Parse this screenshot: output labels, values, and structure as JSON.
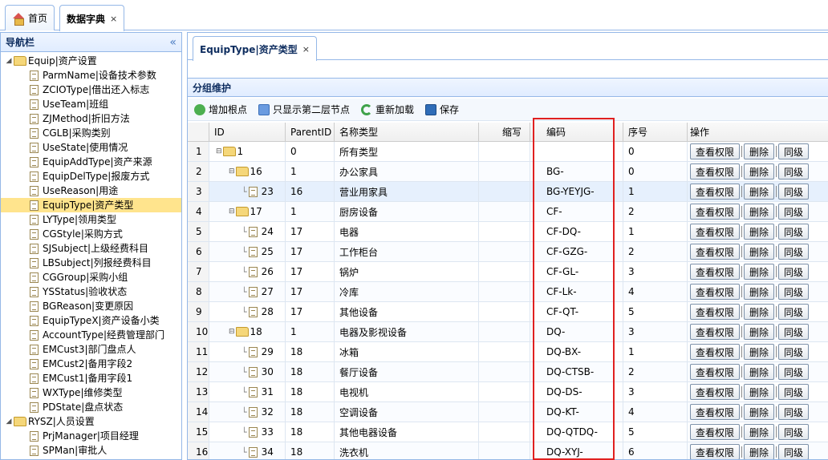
{
  "top_tabs": [
    {
      "label": "首页"
    },
    {
      "label": "数据字典",
      "close": "×"
    }
  ],
  "sidebar": {
    "title": "导航栏",
    "collapse": "«",
    "items": [
      {
        "label": "Equip|资产设置",
        "level": 0,
        "type": "folder"
      },
      {
        "label": "ParmName|设备技术参数",
        "level": 1
      },
      {
        "label": "ZCIOType|借出还入标志",
        "level": 1
      },
      {
        "label": "UseTeam|班组",
        "level": 1
      },
      {
        "label": "ZJMethod|折旧方法",
        "level": 1
      },
      {
        "label": "CGLB|采购类别",
        "level": 1
      },
      {
        "label": "UseState|使用情况",
        "level": 1
      },
      {
        "label": "EquipAddType|资产来源",
        "level": 1
      },
      {
        "label": "EquipDelType|报废方式",
        "level": 1
      },
      {
        "label": "UseReason|用途",
        "level": 1
      },
      {
        "label": "EquipType|资产类型",
        "level": 1,
        "selected": true
      },
      {
        "label": "LYType|领用类型",
        "level": 1
      },
      {
        "label": "CGStyle|采购方式",
        "level": 1
      },
      {
        "label": "SJSubject|上级经费科目",
        "level": 1
      },
      {
        "label": "LBSubject|列报经费科目",
        "level": 1
      },
      {
        "label": "CGGroup|采购小组",
        "level": 1
      },
      {
        "label": "YSStatus|验收状态",
        "level": 1
      },
      {
        "label": "BGReason|变更原因",
        "level": 1
      },
      {
        "label": "EquipTypeX|资产设备小类",
        "level": 1
      },
      {
        "label": "AccountType|经费管理部门",
        "level": 1
      },
      {
        "label": "EMCust3|部门盘点人",
        "level": 1
      },
      {
        "label": "EMCust2|备用字段2",
        "level": 1
      },
      {
        "label": "EMCust1|备用字段1",
        "level": 1
      },
      {
        "label": "WXType|维修类型",
        "level": 1
      },
      {
        "label": "PDState|盘点状态",
        "level": 1
      },
      {
        "label": "RYSZ|人员设置",
        "level": 0,
        "type": "folder"
      },
      {
        "label": "PrjManager|项目经理",
        "level": 1
      },
      {
        "label": "SPMan|审批人",
        "level": 1
      }
    ]
  },
  "inner_tab": {
    "label": "EquipType|资产类型",
    "close": "×"
  },
  "panel_title": "分组维护",
  "toolbar": {
    "add_root": "增加根点",
    "show_second": "只显示第二层节点",
    "reload": "重新加载",
    "save": "保存"
  },
  "grid": {
    "headers": [
      "",
      "ID",
      "ParentID",
      "名称类型",
      "缩写",
      "编码",
      "序号",
      "操作"
    ],
    "actions": {
      "view": "查看权限",
      "delete": "删除",
      "same": "同级"
    },
    "rows": [
      {
        "n": "1",
        "id": "1",
        "pid": "0",
        "name": "所有类型",
        "abbr": "",
        "code": "",
        "seq": "0",
        "depth": 0,
        "folder": true
      },
      {
        "n": "2",
        "id": "16",
        "pid": "1",
        "name": "办公家具",
        "abbr": "",
        "code": "BG-",
        "seq": "0",
        "depth": 1,
        "folder": true
      },
      {
        "n": "3",
        "id": "23",
        "pid": "16",
        "name": "营业用家具",
        "abbr": "",
        "code": "BG-YEYJG-",
        "seq": "1",
        "depth": 2,
        "folder": false
      },
      {
        "n": "4",
        "id": "17",
        "pid": "1",
        "name": "厨房设备",
        "abbr": "",
        "code": "CF-",
        "seq": "2",
        "depth": 1,
        "folder": true
      },
      {
        "n": "5",
        "id": "24",
        "pid": "17",
        "name": "电器",
        "abbr": "",
        "code": "CF-DQ-",
        "seq": "1",
        "depth": 2,
        "folder": false
      },
      {
        "n": "6",
        "id": "25",
        "pid": "17",
        "name": "工作柜台",
        "abbr": "",
        "code": "CF-GZG-",
        "seq": "2",
        "depth": 2,
        "folder": false
      },
      {
        "n": "7",
        "id": "26",
        "pid": "17",
        "name": "锅炉",
        "abbr": "",
        "code": "CF-GL-",
        "seq": "3",
        "depth": 2,
        "folder": false
      },
      {
        "n": "8",
        "id": "27",
        "pid": "17",
        "name": "冷库",
        "abbr": "",
        "code": "CF-Lk-",
        "seq": "4",
        "depth": 2,
        "folder": false
      },
      {
        "n": "9",
        "id": "28",
        "pid": "17",
        "name": "其他设备",
        "abbr": "",
        "code": "CF-QT-",
        "seq": "5",
        "depth": 2,
        "folder": false
      },
      {
        "n": "10",
        "id": "18",
        "pid": "1",
        "name": "电器及影视设备",
        "abbr": "",
        "code": "DQ-",
        "seq": "3",
        "depth": 1,
        "folder": true
      },
      {
        "n": "11",
        "id": "29",
        "pid": "18",
        "name": "冰箱",
        "abbr": "",
        "code": "DQ-BX-",
        "seq": "1",
        "depth": 2,
        "folder": false
      },
      {
        "n": "12",
        "id": "30",
        "pid": "18",
        "name": "餐厅设备",
        "abbr": "",
        "code": "DQ-CTSB-",
        "seq": "2",
        "depth": 2,
        "folder": false
      },
      {
        "n": "13",
        "id": "31",
        "pid": "18",
        "name": "电视机",
        "abbr": "",
        "code": "DQ-DS-",
        "seq": "3",
        "depth": 2,
        "folder": false
      },
      {
        "n": "14",
        "id": "32",
        "pid": "18",
        "name": "空调设备",
        "abbr": "",
        "code": "DQ-KT-",
        "seq": "4",
        "depth": 2,
        "folder": false
      },
      {
        "n": "15",
        "id": "33",
        "pid": "18",
        "name": "其他电器设备",
        "abbr": "",
        "code": "DQ-QTDQ-",
        "seq": "5",
        "depth": 2,
        "folder": false
      },
      {
        "n": "16",
        "id": "34",
        "pid": "18",
        "name": "洗衣机",
        "abbr": "",
        "code": "DQ-XYJ-",
        "seq": "6",
        "depth": 2,
        "folder": false
      }
    ]
  },
  "colors": {
    "border": "#95b8e7",
    "header_bg": "#e0ecff",
    "selected": "#ffe48d",
    "highlight": "#e02020"
  }
}
